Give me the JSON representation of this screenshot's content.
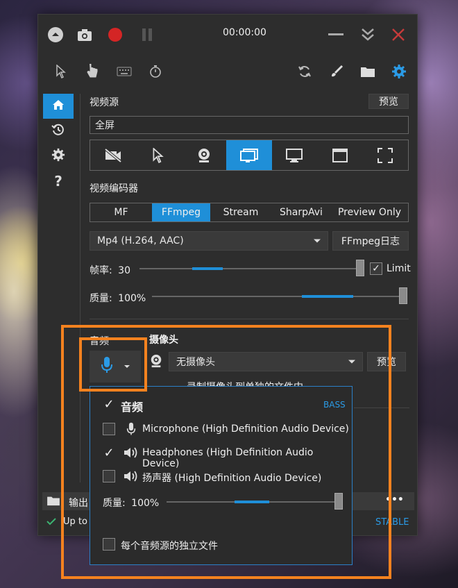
{
  "titlebar": {
    "timer": "00:00:00",
    "icons": [
      "collapse-icon",
      "camera-icon",
      "record-icon",
      "pause-icon",
      "minimize-icon",
      "chevrons-down-icon",
      "close-icon"
    ]
  },
  "toolbar": {
    "icons": [
      "cursor-icon",
      "hand-icon",
      "keyboard-icon",
      "stopwatch-icon",
      "refresh-icon",
      "brush-icon",
      "folder-icon",
      "settings-icon"
    ]
  },
  "sidebar": {
    "items": [
      "home-icon",
      "history-icon",
      "gear-icon",
      "help-icon"
    ],
    "help_label": "?"
  },
  "video_source": {
    "label": "视频源",
    "preview": "预览",
    "value": "全屏",
    "options": [
      "no-video-icon",
      "cursor-region-icon",
      "webcam-icon",
      "screen-icon",
      "monitor-icon",
      "window-icon",
      "fullscreen-icon"
    ],
    "active_index": 3
  },
  "encoder": {
    "label": "视频编码器",
    "tabs": [
      "MF",
      "FFmpeg",
      "Stream",
      "SharpAvi",
      "Preview Only"
    ],
    "active_tab": "FFmpeg",
    "format": "Mp4 (H.264, AAC)",
    "log_button": "FFmpeg日志",
    "fps_label": "帧率:",
    "fps_value": "30",
    "limit_label": "Limit",
    "limit_checked": true,
    "quality_label": "质量:",
    "quality_value": "100%",
    "fps_fill_percent": 14,
    "quality_fill_percent": 100
  },
  "audio": {
    "label": "音频",
    "mic_icon": "microphone-icon"
  },
  "webcam": {
    "label": "摄像头",
    "value": "无摄像头",
    "preview": "预览",
    "separate_file_label": "录制摄像头到单独的文件中"
  },
  "output": {
    "label": "输出",
    "more": "•••"
  },
  "status": {
    "text": "Up to",
    "stable": "STABLE"
  },
  "audio_popup": {
    "title": "音频",
    "title_checked": true,
    "engine": "BASS",
    "devices": [
      {
        "name": "Microphone (High Definition Audio Device)",
        "checked": false,
        "icon": "microphone-icon"
      },
      {
        "name": "Headphones (High Definition Audio Device)",
        "checked": true,
        "icon": "speaker-icon"
      },
      {
        "name": "扬声器 (High Definition Audio Device)",
        "checked": false,
        "icon": "speaker-icon"
      }
    ],
    "quality_label": "质量:",
    "quality_value": "100%",
    "quality_fill_percent": 100,
    "separate_files_label": "每个音频源的独立文件",
    "separate_files_checked": false
  },
  "colors": {
    "accent": "#1f8fd8",
    "highlight": "#f5821f",
    "window_bg": "#2d2d2d"
  }
}
